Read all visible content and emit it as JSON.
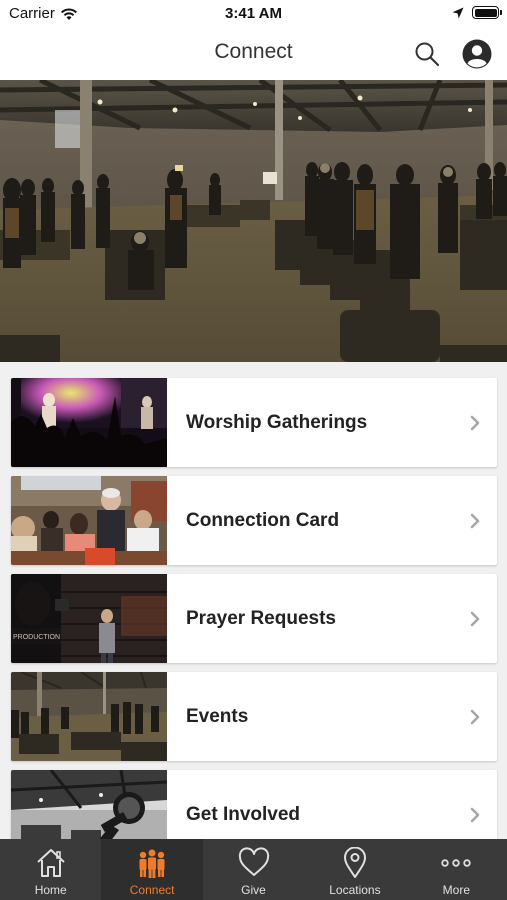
{
  "status_bar": {
    "carrier": "Carrier",
    "time": "3:41 AM"
  },
  "nav": {
    "title": "Connect",
    "search_icon": "search-icon",
    "profile_icon": "profile-icon"
  },
  "hero": {
    "description_icon": "worship-hall-photo"
  },
  "cards": [
    {
      "label": "Worship Gatherings"
    },
    {
      "label": "Connection Card"
    },
    {
      "label": "Prayer Requests"
    },
    {
      "label": "Events"
    },
    {
      "label": "Get Involved"
    }
  ],
  "tabs": [
    {
      "label": "Home",
      "icon": "home-icon"
    },
    {
      "label": "Connect",
      "icon": "people-icon",
      "active": true
    },
    {
      "label": "Give",
      "icon": "heart-icon"
    },
    {
      "label": "Locations",
      "icon": "location-pin-icon"
    },
    {
      "label": "More",
      "icon": "more-dots-icon"
    }
  ],
  "colors": {
    "accent": "#f07c2a",
    "tab_bar": "#3a3a3a"
  }
}
